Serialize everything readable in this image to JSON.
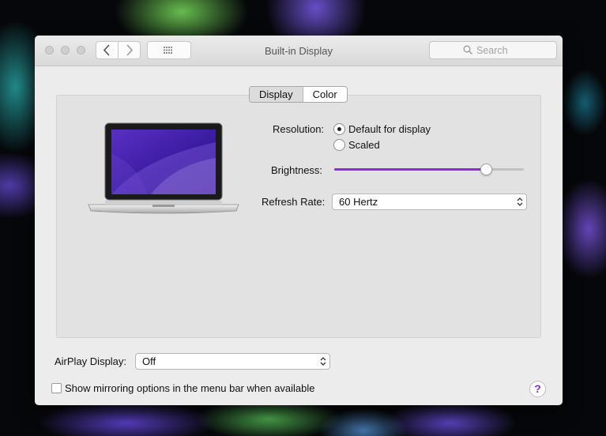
{
  "window": {
    "title": "Built-in Display"
  },
  "search": {
    "placeholder": "Search"
  },
  "tabs": [
    {
      "label": "Display",
      "selected": true
    },
    {
      "label": "Color",
      "selected": false
    }
  ],
  "resolution": {
    "label": "Resolution:",
    "options": [
      {
        "label": "Default for display",
        "selected": true
      },
      {
        "label": "Scaled",
        "selected": false
      }
    ]
  },
  "brightness": {
    "label": "Brightness:",
    "value": 0.8
  },
  "refresh_rate": {
    "label": "Refresh Rate:",
    "value": "60 Hertz"
  },
  "airplay": {
    "label": "AirPlay Display:",
    "value": "Off"
  },
  "mirroring": {
    "label": "Show mirroring options in the menu bar when available",
    "checked": false
  },
  "help": {
    "label": "?"
  },
  "colors": {
    "accent": "#8c2be2",
    "window_bg": "#ececec",
    "panel_bg": "#e2e2e2"
  },
  "icons": [
    "close-button",
    "minimize-button",
    "zoom-button",
    "chevron-left-icon",
    "chevron-right-icon",
    "grid-icon",
    "search-icon",
    "laptop-image",
    "stepper-icon"
  ]
}
